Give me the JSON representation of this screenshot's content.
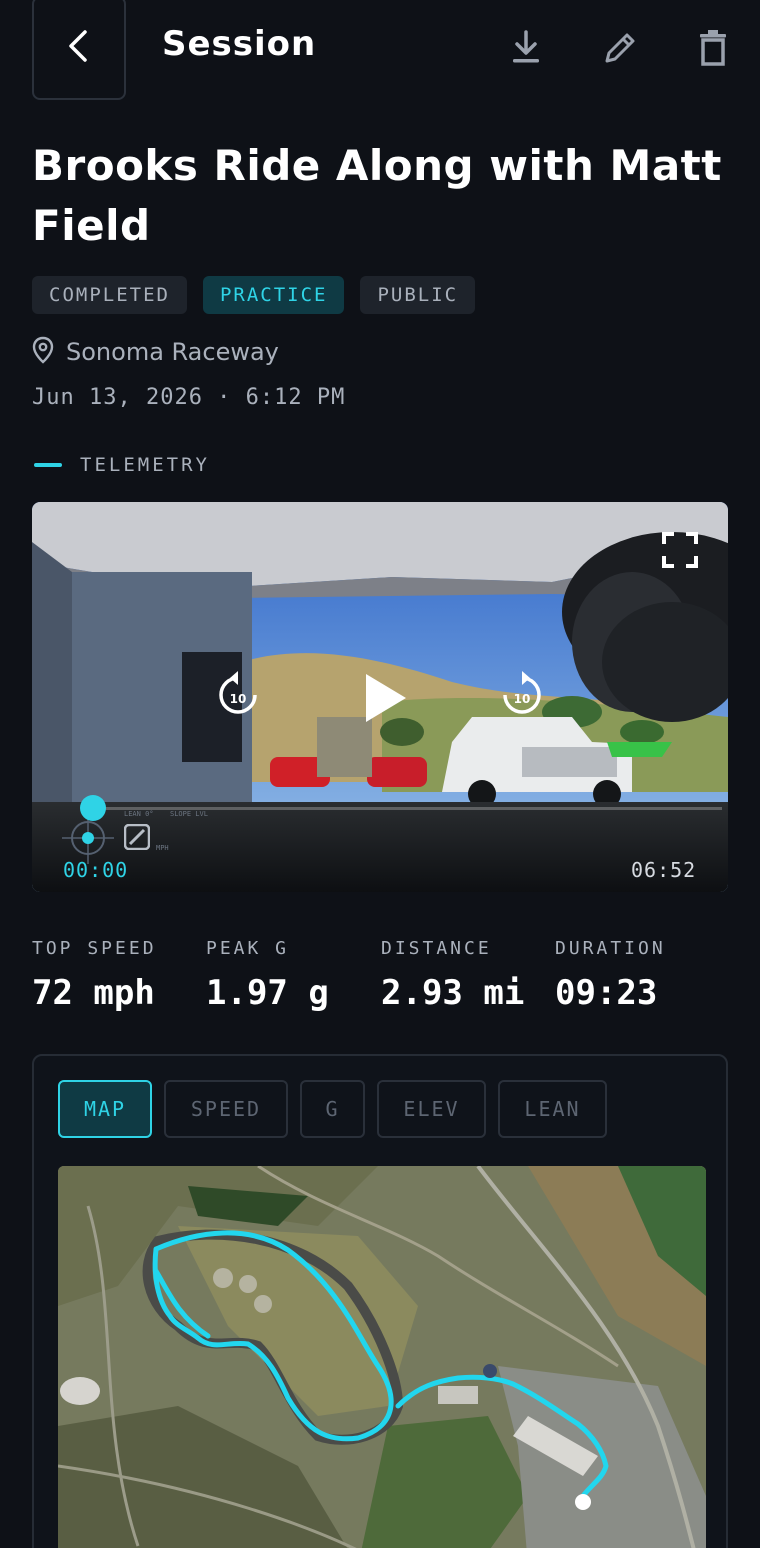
{
  "header": {
    "title": "Session",
    "back_icon": "chevron-left-icon",
    "actions": [
      "download-icon",
      "edit-icon",
      "trash-icon"
    ]
  },
  "session": {
    "title": "Brooks Ride Along with Matt Field",
    "badges": {
      "status": "COMPLETED",
      "type": "PRACTICE",
      "visibility": "PUBLIC"
    },
    "location": "Sonoma Raceway",
    "datetime": "Jun 13, 2026 · 6:12 PM"
  },
  "telemetry": {
    "section_label": "TELEMETRY",
    "video": {
      "current_time": "00:00",
      "total_time": "06:52",
      "rewind_seconds": "10",
      "forward_seconds": "10",
      "progress": 0,
      "hud_small_labels": [
        "LEAN 0°",
        "SLOPE LVL",
        "MPH"
      ]
    }
  },
  "stats": {
    "top_speed": {
      "label": "TOP SPEED",
      "value": "72 mph"
    },
    "peak_g": {
      "label": "PEAK G",
      "value": "1.97 g"
    },
    "distance": {
      "label": "DISTANCE",
      "value": "2.93 mi"
    },
    "duration": {
      "label": "DURATION",
      "value": "09:23"
    }
  },
  "chart_tabs": {
    "active": "MAP",
    "items": [
      "MAP",
      "SPEED",
      "G",
      "ELEV",
      "LEAN"
    ]
  },
  "colors": {
    "background": "#0e1117",
    "accent": "#2fd3e6",
    "muted_text": "#aab1bc",
    "track_line": "#22d6ee"
  }
}
